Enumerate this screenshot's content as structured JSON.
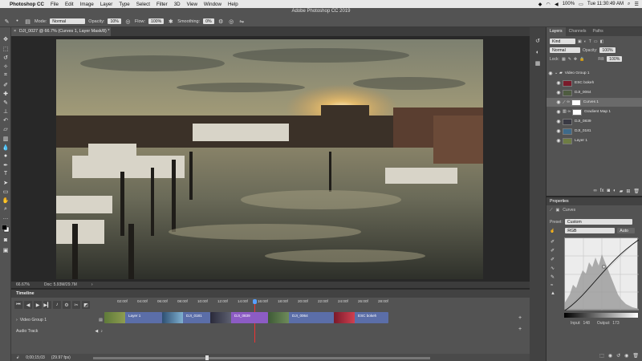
{
  "menubar": {
    "apple": "",
    "app_name": "Photoshop CC",
    "items": [
      "File",
      "Edit",
      "Image",
      "Layer",
      "Type",
      "Select",
      "Filter",
      "3D",
      "View",
      "Window",
      "Help"
    ],
    "battery": "100%",
    "clock": "Tue 11:30:49 AM"
  },
  "window": {
    "title": "Adobe Photoshop CC 2019"
  },
  "options_bar": {
    "mode_label": "Mode:",
    "mode_value": "Normal",
    "opacity_label": "Opacity:",
    "opacity_value": "10%",
    "flow_label": "Flow:",
    "flow_value": "100%",
    "smoothing_label": "Smoothing:",
    "smoothing_value": "0%"
  },
  "document": {
    "tab_label": "DJI_0027 @ 66.7% (Curves 1, Layer Mask/8) *",
    "zoom": "66.67%",
    "doc_size": "Doc: 5.93M/29.7M"
  },
  "timeline": {
    "title": "Timeline",
    "ruler_ticks": [
      "02:00f",
      "04:00f",
      "06:00f",
      "08:00f",
      "10:00f",
      "12:00f",
      "14:00f",
      "16:00f",
      "18:00f",
      "20:00f",
      "22:00f",
      "24:00f",
      "26:00f",
      "28:00f"
    ],
    "track_video": "Video Group 1",
    "track_audio": "Audio Track",
    "clips": [
      {
        "label": "Layer 1",
        "color": "#5b6ea8"
      },
      {
        "label": "DJI_0181",
        "color": "#5b6ea8"
      },
      {
        "label": "DJI_0839",
        "color": "#8c5cc4"
      },
      {
        "label": "DJI_0064",
        "color": "#5b6ea8"
      },
      {
        "label": "ESC bokeh",
        "color": "#5b6ea8"
      }
    ],
    "timecode": "0;00;15;03",
    "fps": "(29.97 fps)"
  },
  "layers_panel": {
    "tabs": [
      "Layers",
      "Channels",
      "Paths"
    ],
    "filter_kind": "Kind",
    "blend_mode": "Normal",
    "opacity_label": "Opacity:",
    "opacity_value": "100%",
    "lock_label": "Lock:",
    "fill_label": "Fill:",
    "fill_value": "100%",
    "layers": [
      {
        "name": "Video Group 1",
        "type": "group"
      },
      {
        "name": "ESC bokeh",
        "type": "video"
      },
      {
        "name": "DJI_0064",
        "type": "video"
      },
      {
        "name": "Curves 1",
        "type": "adjustment",
        "selected": true
      },
      {
        "name": "Gradient Map 1",
        "type": "adjustment"
      },
      {
        "name": "DJI_0839",
        "type": "video"
      },
      {
        "name": "DJI_0181",
        "type": "video"
      },
      {
        "name": "Layer 1",
        "type": "video"
      }
    ]
  },
  "properties_panel": {
    "title": "Properties",
    "adjustment": "Curves",
    "preset_label": "Preset:",
    "preset_value": "Custom",
    "channel": "RGB",
    "auto_label": "Auto",
    "input_label": "Input:",
    "input_value": "148",
    "output_label": "Output:",
    "output_value": "173"
  }
}
